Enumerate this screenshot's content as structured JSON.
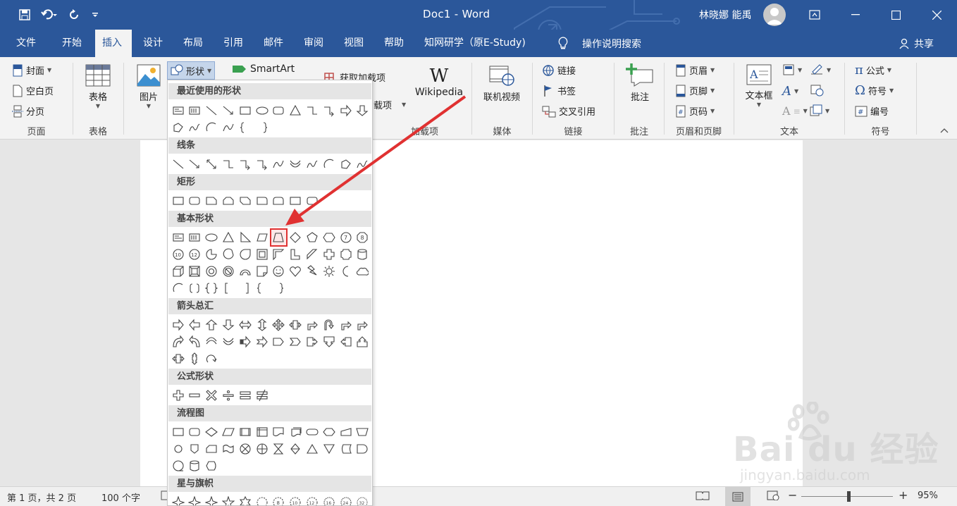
{
  "window": {
    "title": "Doc1  -  Word",
    "user": "林晓娜 能禹"
  },
  "tabs": [
    "文件",
    "开始",
    "插入",
    "设计",
    "布局",
    "引用",
    "邮件",
    "审阅",
    "视图",
    "帮助",
    "知网研学（原E-Study)"
  ],
  "tell_me": "操作说明搜索",
  "share": "共享",
  "ribbon": {
    "pages": {
      "label": "页面",
      "cover": "封面",
      "blank": "空白页",
      "break": "分页"
    },
    "tables": {
      "label": "表格",
      "table": "表格"
    },
    "illustrations": {
      "picture": "图片",
      "shapes": "形状",
      "smartart": "SmartArt"
    },
    "addins": {
      "label": "加载项",
      "get": "获取加载项",
      "mine": "载项",
      "wikipedia": "Wikipedia"
    },
    "media": {
      "label": "媒体",
      "video": "联机视频"
    },
    "links": {
      "label": "链接",
      "link": "链接",
      "bookmark": "书签",
      "crossref": "交叉引用"
    },
    "comments": {
      "label": "批注",
      "comment": "批注"
    },
    "headerfooter": {
      "label": "页眉和页脚",
      "header": "页眉",
      "footer": "页脚",
      "pagenum": "页码"
    },
    "text": {
      "label": "文本",
      "textbox": "文本框"
    },
    "symbols": {
      "label": "符号",
      "equation": "公式",
      "symbol": "符号",
      "number": "编号"
    }
  },
  "shapes_menu": {
    "categories": [
      "最近使用的形状",
      "线条",
      "矩形",
      "基本形状",
      "箭头总汇",
      "公式形状",
      "流程图",
      "星与旗帜"
    ]
  },
  "statusbar": {
    "page": "第 1 页，共 2 页",
    "words": "100 个字",
    "zoom": "95%"
  },
  "watermark": {
    "text": "Bai  du 经验",
    "sub": "jingyan.baidu.com"
  },
  "colors": {
    "accent": "#2b579a",
    "highlight": "#e03131"
  }
}
